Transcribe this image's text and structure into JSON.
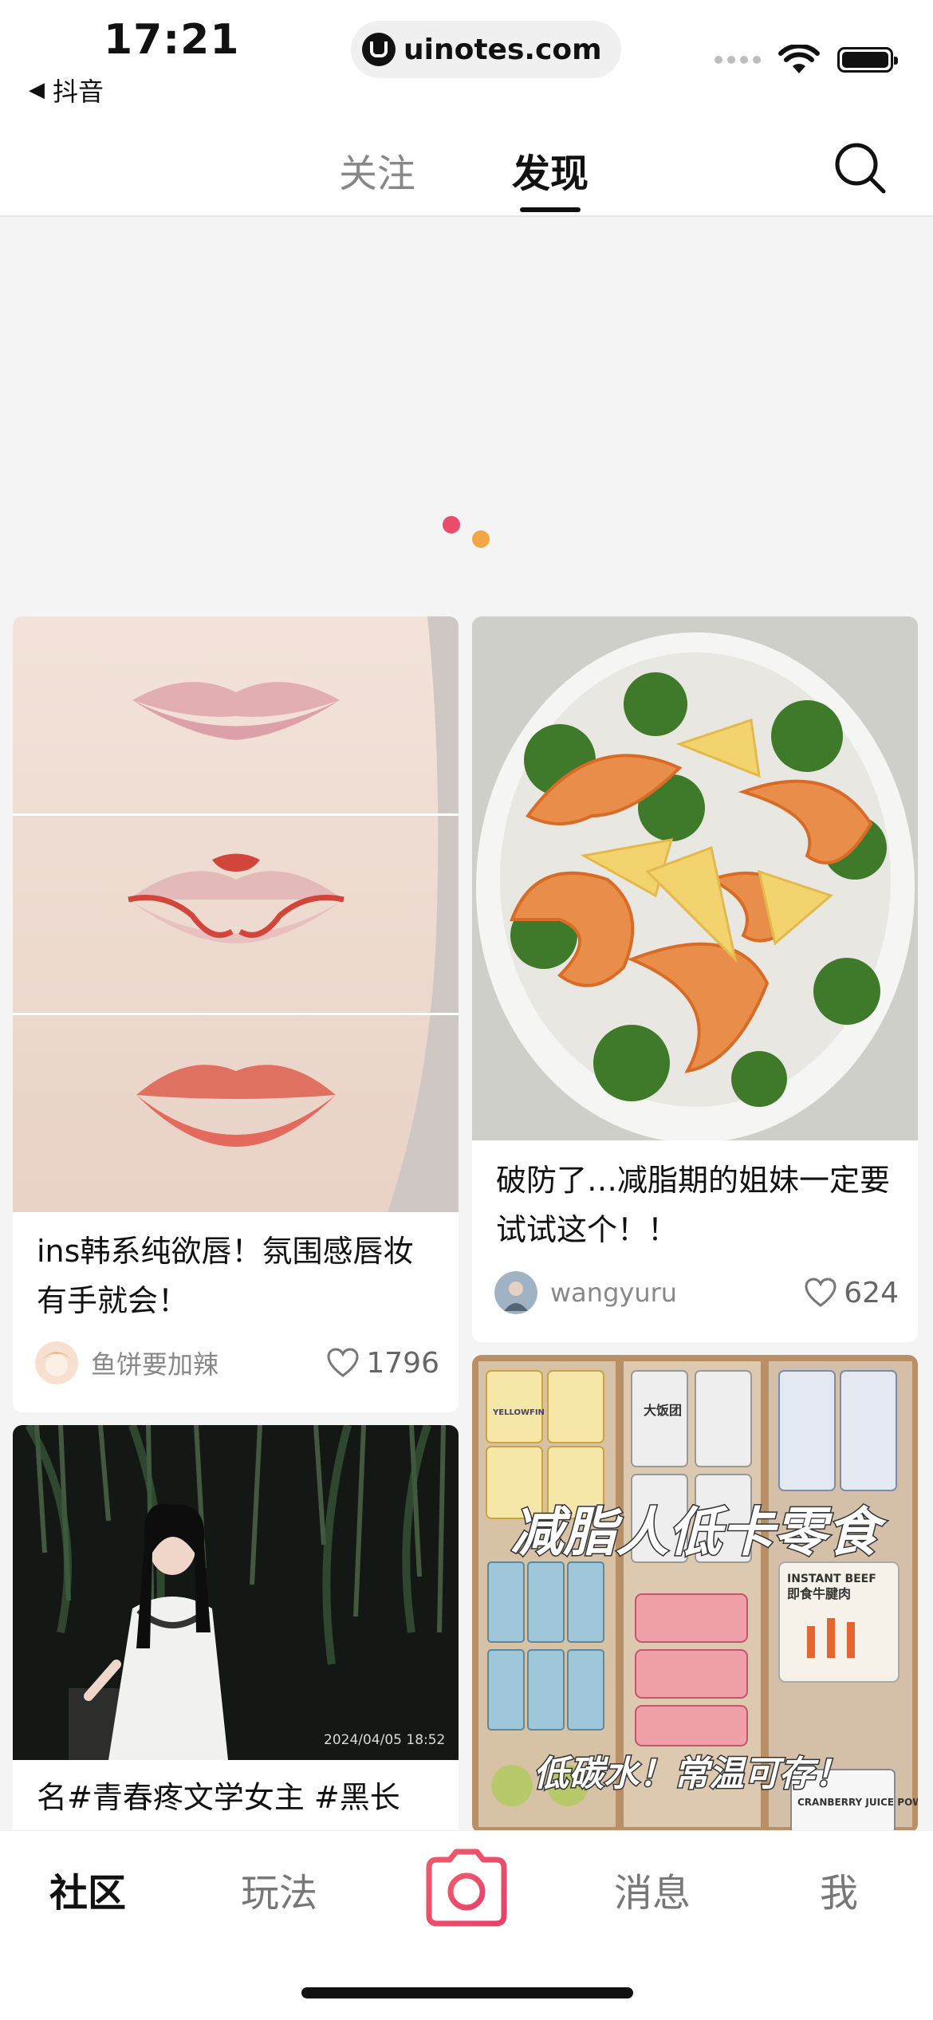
{
  "status_bar": {
    "time": "17:21",
    "back_app": "抖音",
    "url": "uinotes.com"
  },
  "top_nav": {
    "tabs": [
      {
        "label": "关注"
      },
      {
        "label": "发现"
      }
    ],
    "active_tab": "发现"
  },
  "feed": {
    "left": [
      {
        "title": "ins韩系纯欲唇！氛围感唇妆有手就会！",
        "author": "鱼饼要加辣",
        "likes": "1796"
      },
      {
        "title": "名#青春疼文学女主 #黑长",
        "photo_text": "2024/04/05 18:52"
      }
    ],
    "right": [
      {
        "title": "破防了…减脂期的姐妹一定要试试这个！！",
        "author": "wangyuru",
        "likes": "624"
      },
      {
        "overlay_top": "减脂人低卡零食",
        "overlay_bottom": "低碳水！常温可存！",
        "pkg_labels": [
          "YELLOWFIN",
          "大饭团",
          "INSTANT BEEF",
          "即食牛腱肉",
          "CRANBERRY JUICE POWDER"
        ]
      }
    ]
  },
  "tab_bar": {
    "items": [
      {
        "label": "社区"
      },
      {
        "label": "玩法"
      },
      {
        "label": "消息"
      },
      {
        "label": "我"
      }
    ],
    "active": "社区"
  },
  "colors": {
    "accent": "#ea4c6b",
    "loading_dot2": "#f3a646"
  }
}
